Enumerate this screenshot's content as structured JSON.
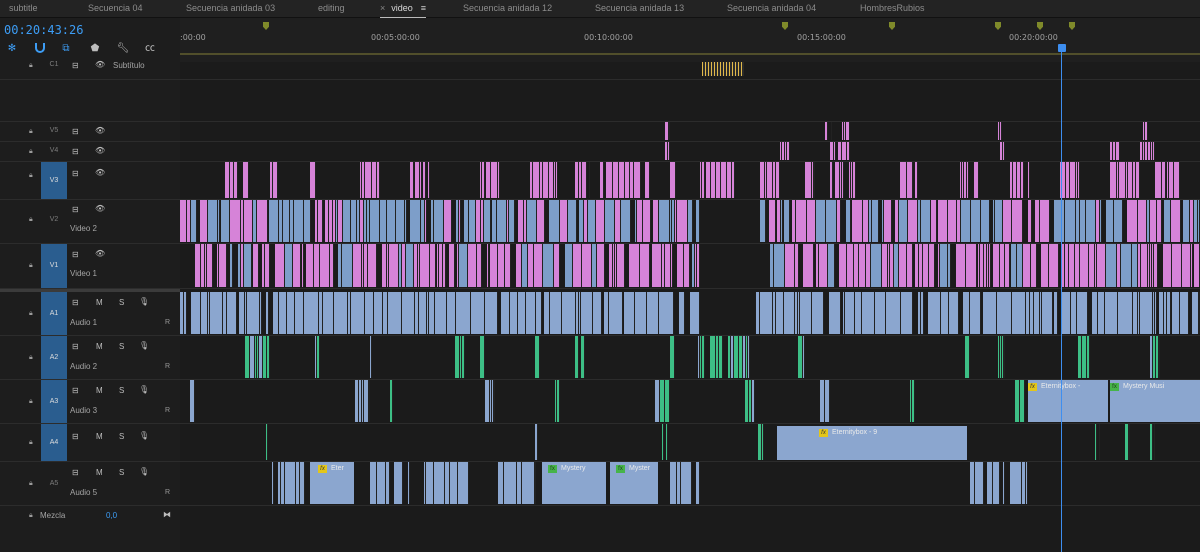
{
  "tabs": [
    {
      "label": "subtitle",
      "active": false
    },
    {
      "label": "Secuencia 04",
      "active": false
    },
    {
      "label": "Secuencia anidada 03",
      "active": false
    },
    {
      "label": "editing",
      "active": false
    },
    {
      "label": "video",
      "active": true
    },
    {
      "label": "Secuencia anidada 12",
      "active": false
    },
    {
      "label": "Secuencia anidada 13",
      "active": false
    },
    {
      "label": "Secuencia anidada 04",
      "active": false
    },
    {
      "label": "HombresRubios",
      "active": false
    }
  ],
  "tab_close": "×",
  "tab_menu": "≡",
  "timecode": "00:20:43:26",
  "ruler": {
    "labels": [
      ":00:00",
      "00:05:00:00",
      "00:10:00:00",
      "00:15:00:00",
      "00:20:00:00"
    ]
  },
  "tracks": {
    "c1": {
      "id": "C1",
      "name": "Subtítulo"
    },
    "v5": {
      "id": "V5"
    },
    "v4": {
      "id": "V4"
    },
    "v3": {
      "id": "V3"
    },
    "v2": {
      "id": "V2",
      "name": "Video 2"
    },
    "v1": {
      "id": "V1",
      "name": "Video 1"
    },
    "a1": {
      "id": "A1",
      "name": "Audio 1",
      "m": "M",
      "s": "S",
      "r": "R"
    },
    "a2": {
      "id": "A2",
      "name": "Audio 2",
      "m": "M",
      "s": "S",
      "r": "R"
    },
    "a3": {
      "id": "A3",
      "name": "Audio 3",
      "m": "M",
      "s": "S",
      "r": "R"
    },
    "a4": {
      "id": "A4",
      "name": "Audio 4",
      "m": "M",
      "s": "S",
      "r": "R"
    },
    "a5": {
      "id": "A5",
      "name": "Audio 5",
      "m": "M",
      "s": "S",
      "r": "R"
    }
  },
  "mix": {
    "label": "Mezcla",
    "value": "0,0"
  },
  "clip_labels": {
    "a3_eternitybox": "Eternitybox -",
    "a3_mystery": "Mystery Musi",
    "a4_eternitybox": "Eternitybox - 9",
    "a5_eter": "Eter",
    "a5_mystery1": "Mystery",
    "a5_mystery2": "Myster"
  },
  "colors": {
    "accent": "#3d9df5",
    "video_pink": "#d683d8",
    "video_blue": "#7d9ec9",
    "audio_blue": "#8ba6cf",
    "audio_green": "#3dbf86",
    "work_area": "#e6d400"
  }
}
